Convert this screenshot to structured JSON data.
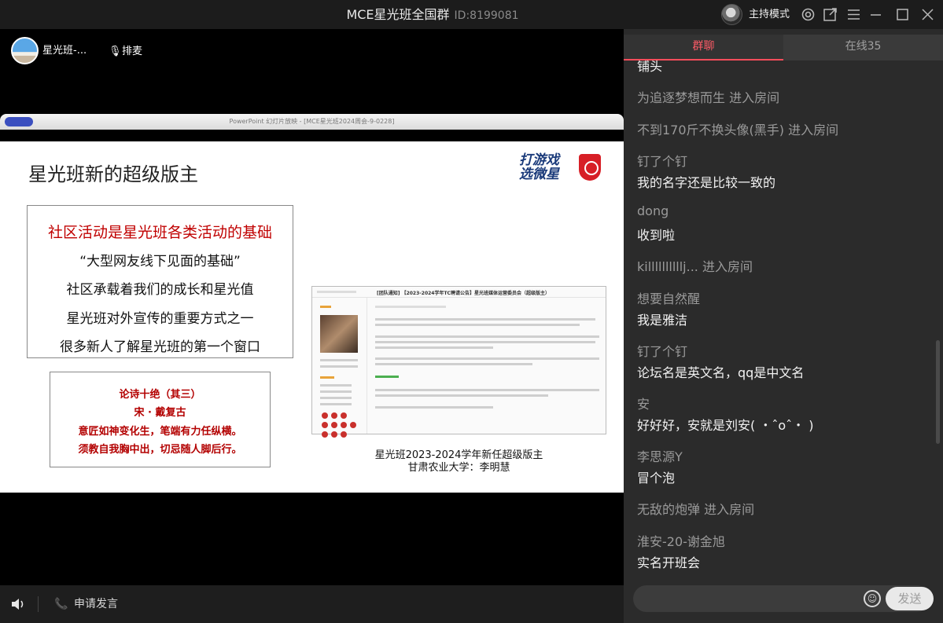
{
  "window": {
    "title": "MCE星光班全国群",
    "id_text": "ID:8199081",
    "host_mode_label": "主持模式",
    "icons": [
      "host-avatar",
      "settings-icon",
      "popout-icon",
      "menu-icon",
      "minimize-icon",
      "maximize-icon",
      "close-icon"
    ]
  },
  "stage": {
    "presenter_name": "星光班-...",
    "queue_label": "排麦",
    "ppt_window_title": "PowerPoint 幻灯片放映 - [MCE星光班2024周会-9-0228]"
  },
  "slide": {
    "title": "星光班新的超级版主",
    "logo_text": "打游戏\n选微星",
    "main_box": [
      "社区活动是星光班各类活动的基础",
      "“大型网友线下见面的基础”",
      "社区承载着我们的成长和星光值",
      "星光班对外宣传的重要方式之一",
      "很多新人了解星光班的第一个窗口"
    ],
    "poem": [
      "论诗十绝（其三）",
      "宋 · 戴复古",
      "意匠如神变化生，笔端有力任纵横。",
      "须教自我胸中出，切忌随人脚后行。"
    ],
    "forum_title": "[团队通知] 【2023-2024学年TC聘请公告】星光班媒体运营委员会（超级版主）",
    "caption_line1": "星光班2023-2024学年新任超级版主",
    "caption_line2": "甘肃农业大学：李明慧"
  },
  "bottom": {
    "apply_label": "申请发言"
  },
  "chat": {
    "tabs": [
      "群聊",
      "在线35"
    ],
    "messages": [
      {
        "type": "text",
        "text": "铺头"
      },
      {
        "type": "system",
        "text": "为追逐梦想而生 进入房间"
      },
      {
        "type": "system",
        "text": "不到170斤不换头像(黑手)  进入房间"
      },
      {
        "type": "message",
        "nick": "钉了个钉",
        "text": "我的名字还是比较一致的"
      },
      {
        "type": "message",
        "nick": "dong",
        "text": "收到啦"
      },
      {
        "type": "system",
        "text": "killllllllllj... 进入房间"
      },
      {
        "type": "message",
        "nick": "想要自然醒",
        "text": "我是雅洁"
      },
      {
        "type": "message",
        "nick": "钉了个钉",
        "text": "论坛名是英文名，qq是中文名"
      },
      {
        "type": "message",
        "nick": "安",
        "text": "好好好，安就是刘安( ・ˆoˆ・ )"
      },
      {
        "type": "message",
        "nick": "李思源Y",
        "text": "冒个泡"
      },
      {
        "type": "system",
        "text": "无敌的炮弹 进入房间"
      },
      {
        "type": "message",
        "nick": "淮安-20-谢金旭",
        "text": "实名开班会"
      }
    ],
    "input_placeholder": "",
    "send_label": "发送"
  }
}
